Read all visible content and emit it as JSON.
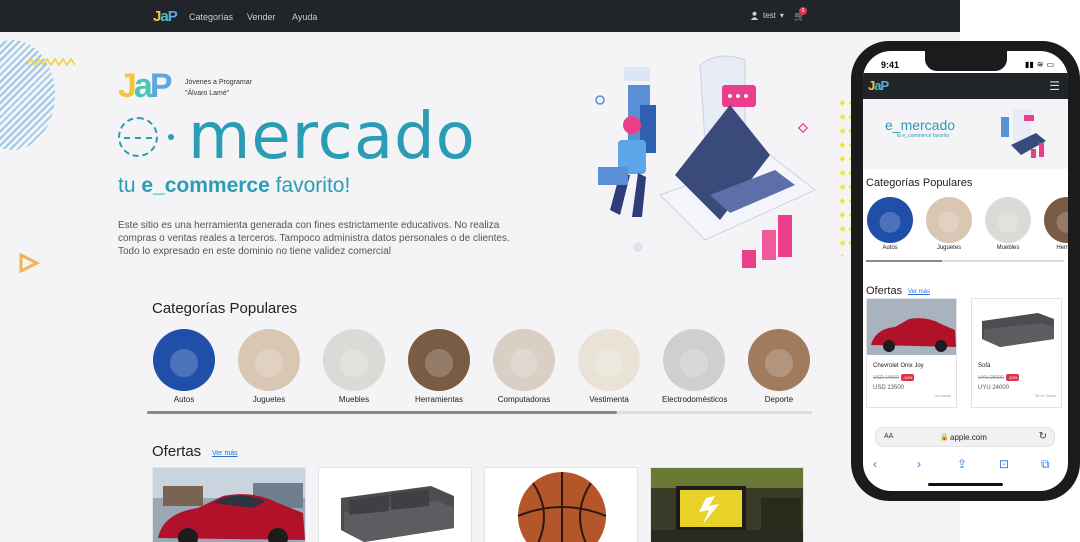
{
  "navbar": {
    "logo": {
      "j": "J",
      "a": "a",
      "p": "P"
    },
    "links": [
      "Categorías",
      "Vender",
      "Ayuda"
    ],
    "user": "test",
    "cart_count": "0",
    "icons": [
      "user-icon",
      "cart-icon"
    ]
  },
  "hero": {
    "org_line1": "Jóvenes a Programar",
    "org_line2": "\"Álvaro Lamé\"",
    "title": "mercado",
    "subtitle_prefix": "tu ",
    "subtitle_bold": "e_commerce",
    "subtitle_suffix": " favorito!",
    "description": "Este sitio  es una herramienta generada con fines estrictamente educativos. No realiza compras o ventas reales a terceros. Tampoco administra datos personales o de clientes. Todo lo expresado en este dominio no tiene validez comercial"
  },
  "categories": {
    "title": "Categorías Populares",
    "items": [
      {
        "label": "Autos",
        "color": "#1f4fa8"
      },
      {
        "label": "Juguetes",
        "color": "#d9c6b3"
      },
      {
        "label": "Muebles",
        "color": "#dcdad6"
      },
      {
        "label": "Herramientas",
        "color": "#7a5b44"
      },
      {
        "label": "Computadoras",
        "color": "#d9cfc4"
      },
      {
        "label": "Vestimenta",
        "color": "#e9e2d6"
      },
      {
        "label": "Electrodomésticos",
        "color": "#cfcfcf"
      },
      {
        "label": "Deporte",
        "color": "#a07b5c"
      }
    ]
  },
  "offers": {
    "title": "Ofertas",
    "more_link": "Ver más"
  },
  "phone": {
    "time": "9:41",
    "status_icons": [
      "signal-icon",
      "wifi-icon",
      "battery-icon"
    ],
    "hero_title": "e_mercado",
    "hero_sub": "tu e_commerce favorito",
    "categories_title": "Categorías Populares",
    "categories": [
      "Autos",
      "Juguetes",
      "Muebles",
      "Herrami"
    ],
    "offers_title": "Ofertas",
    "offers_more": "Ver más",
    "cards": [
      {
        "name": "Chevrolet Onix Joy",
        "old_price": "USD 14500",
        "discount": "-10%",
        "price": "USD 13500",
        "stock": "+un stock"
      },
      {
        "name": "Sofá",
        "old_price": "UYU 26000",
        "discount": "-10%",
        "price": "UYU 24000",
        "stock": "39 en Stock"
      }
    ],
    "address_bar": {
      "aa": "AA",
      "url": "apple.com"
    },
    "toolbar_icons": [
      "back-icon",
      "forward-icon",
      "share-icon",
      "bookmarks-icon",
      "tabs-icon"
    ]
  },
  "colors": {
    "brand": "#2a9db5",
    "navbar": "#212529",
    "link": "#2a6fd6",
    "badge": "#dc3545"
  }
}
